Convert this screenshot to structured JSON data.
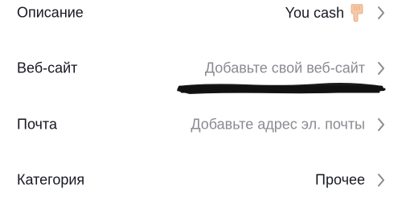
{
  "profile_fields": [
    {
      "label": "Описание",
      "value": "You cash",
      "value_icon": "pointing-down-hand-emoji",
      "chevron_icon": "chevron-right-icon"
    },
    {
      "label": "Веб-сайт",
      "value": "Добавьте свой веб-сайт",
      "chevron_icon": "chevron-right-icon"
    },
    {
      "label": "Почта",
      "value": "Добавьте адрес эл. почты",
      "chevron_icon": "chevron-right-icon"
    },
    {
      "label": "Категория",
      "value": "Прочее",
      "chevron_icon": "chevron-right-icon"
    }
  ],
  "colors": {
    "text_primary": "#161823",
    "text_placeholder": "#8a8b91",
    "chevron": "#8a8b91",
    "redaction": "#1b1b1b",
    "background": "#ffffff"
  }
}
